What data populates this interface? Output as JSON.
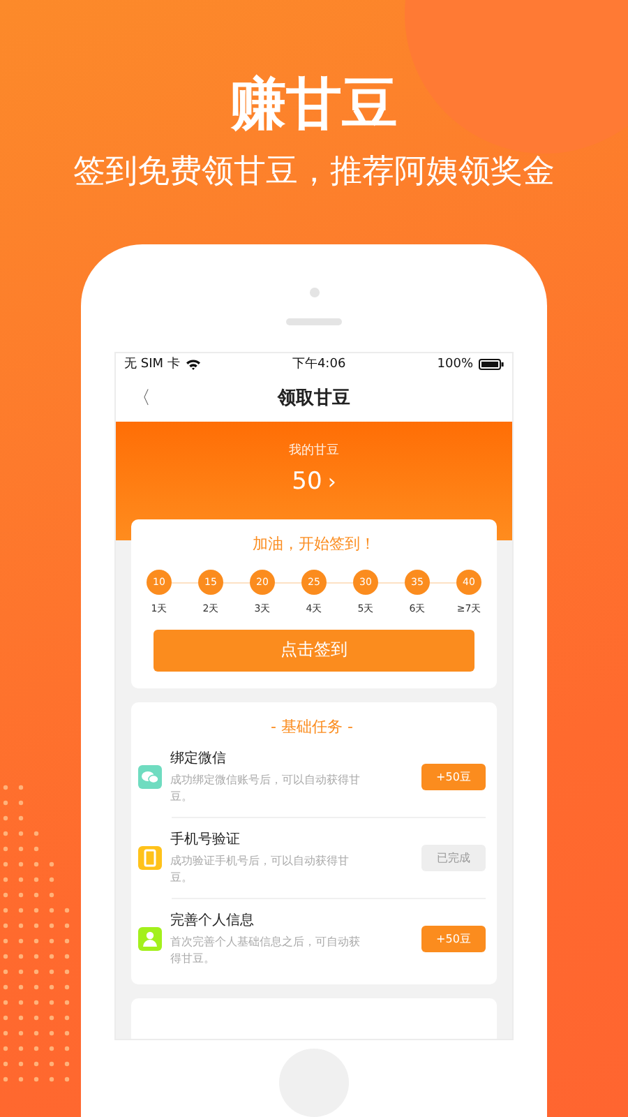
{
  "promo": {
    "title": "赚甘豆",
    "subtitle": "签到免费领甘豆，推荐阿姨领奖金"
  },
  "status_bar": {
    "carrier": "无 SIM 卡",
    "time": "下午4:06",
    "battery": "100%"
  },
  "nav": {
    "back": "〈",
    "title": "领取甘豆"
  },
  "balance": {
    "label": "我的甘豆",
    "value": "50",
    "arrow": "›"
  },
  "checkin": {
    "title": "加油，开始签到！",
    "days": [
      {
        "points": "10",
        "label": "1天"
      },
      {
        "points": "15",
        "label": "2天"
      },
      {
        "points": "20",
        "label": "3天"
      },
      {
        "points": "25",
        "label": "4天"
      },
      {
        "points": "30",
        "label": "5天"
      },
      {
        "points": "35",
        "label": "6天"
      },
      {
        "points": "40",
        "label": "≥7天"
      }
    ],
    "button": "点击签到"
  },
  "basic_tasks": {
    "title": "- 基础任务 -",
    "items": [
      {
        "name": "绑定微信",
        "description": "成功绑定微信账号后，可以自动获得甘豆。",
        "action": "+50豆",
        "completed": false,
        "color": "#6fdcc0"
      },
      {
        "name": "手机号验证",
        "description": "成功验证手机号后，可以自动获得甘豆。",
        "action": "已完成",
        "completed": true,
        "color": "#ffc21a"
      },
      {
        "name": "完善个人信息",
        "description": "首次完善个人基础信息之后，可自动获得甘豆。",
        "action": "+50豆",
        "completed": false,
        "color": "#a3f01c"
      }
    ]
  }
}
